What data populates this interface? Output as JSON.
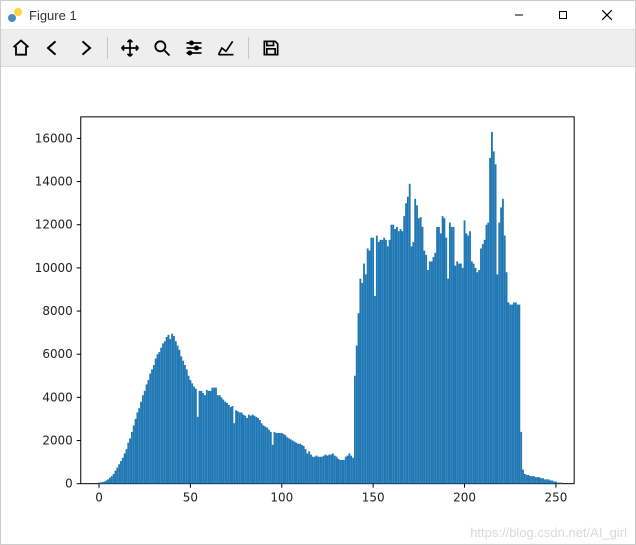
{
  "window": {
    "title": "Figure 1"
  },
  "toolbar": {
    "home": "Home",
    "back": "Back",
    "forward": "Forward",
    "pan": "Pan",
    "zoom": "Zoom",
    "configure": "Configure subplots",
    "axes": "Edit axis",
    "save": "Save"
  },
  "watermark": "https://blog.csdn.net/AI_girl",
  "chart_data": {
    "type": "bar",
    "title": "",
    "xlabel": "",
    "ylabel": "",
    "xlim": [
      -10,
      260
    ],
    "ylim": [
      0,
      17000
    ],
    "xticks": [
      0,
      50,
      100,
      150,
      200,
      250
    ],
    "yticks": [
      0,
      2000,
      4000,
      6000,
      8000,
      10000,
      12000,
      14000,
      16000
    ],
    "color": "#1f77b4",
    "x": [
      0,
      1,
      2,
      3,
      4,
      5,
      6,
      7,
      8,
      9,
      10,
      11,
      12,
      13,
      14,
      15,
      16,
      17,
      18,
      19,
      20,
      21,
      22,
      23,
      24,
      25,
      26,
      27,
      28,
      29,
      30,
      31,
      32,
      33,
      34,
      35,
      36,
      37,
      38,
      39,
      40,
      41,
      42,
      43,
      44,
      45,
      46,
      47,
      48,
      49,
      50,
      51,
      52,
      53,
      54,
      55,
      56,
      57,
      58,
      59,
      60,
      61,
      62,
      63,
      64,
      65,
      66,
      67,
      68,
      69,
      70,
      71,
      72,
      73,
      74,
      75,
      76,
      77,
      78,
      79,
      80,
      81,
      82,
      83,
      84,
      85,
      86,
      87,
      88,
      89,
      90,
      91,
      92,
      93,
      94,
      95,
      96,
      97,
      98,
      99,
      100,
      101,
      102,
      103,
      104,
      105,
      106,
      107,
      108,
      109,
      110,
      111,
      112,
      113,
      114,
      115,
      116,
      117,
      118,
      119,
      120,
      121,
      122,
      123,
      124,
      125,
      126,
      127,
      128,
      129,
      130,
      131,
      132,
      133,
      134,
      135,
      136,
      137,
      138,
      139,
      140,
      141,
      142,
      143,
      144,
      145,
      146,
      147,
      148,
      149,
      150,
      151,
      152,
      153,
      154,
      155,
      156,
      157,
      158,
      159,
      160,
      161,
      162,
      163,
      164,
      165,
      166,
      167,
      168,
      169,
      170,
      171,
      172,
      173,
      174,
      175,
      176,
      177,
      178,
      179,
      180,
      181,
      182,
      183,
      184,
      185,
      186,
      187,
      188,
      189,
      190,
      191,
      192,
      193,
      194,
      195,
      196,
      197,
      198,
      199,
      200,
      201,
      202,
      203,
      204,
      205,
      206,
      207,
      208,
      209,
      210,
      211,
      212,
      213,
      214,
      215,
      216,
      217,
      218,
      219,
      220,
      221,
      222,
      223,
      224,
      225,
      226,
      227,
      228,
      229,
      230,
      231,
      232,
      233,
      234,
      235,
      236,
      237,
      238,
      239,
      240,
      241,
      242,
      243,
      244,
      245,
      246,
      247,
      248,
      249,
      250,
      251,
      252,
      253,
      254,
      255
    ],
    "values": [
      50,
      60,
      80,
      100,
      150,
      200,
      280,
      350,
      450,
      600,
      750,
      900,
      1050,
      1200,
      1400,
      1600,
      1900,
      2100,
      2400,
      2700,
      3000,
      3300,
      3500,
      3800,
      4100,
      4300,
      4600,
      4800,
      5100,
      5300,
      5500,
      5800,
      6000,
      6100,
      6300,
      6500,
      6600,
      6800,
      6900,
      6700,
      6950,
      6850,
      6600,
      6400,
      6200,
      5900,
      5700,
      5500,
      5300,
      5000,
      4800,
      4650,
      4500,
      4400,
      3100,
      4300,
      4300,
      4200,
      4100,
      4350,
      4300,
      4300,
      4450,
      4450,
      4450,
      4100,
      4100,
      4000,
      3900,
      3800,
      3750,
      3650,
      3550,
      3600,
      2800,
      3400,
      3350,
      3300,
      3300,
      3200,
      3150,
      3050,
      3200,
      3150,
      3200,
      3150,
      3100,
      3050,
      2950,
      2800,
      2700,
      2650,
      2600,
      2500,
      2400,
      1800,
      2400,
      2350,
      2350,
      2350,
      2350,
      2300,
      2250,
      2150,
      2100,
      2050,
      2000,
      1950,
      1900,
      1850,
      1850,
      1800,
      1750,
      1600,
      1400,
      1500,
      1350,
      1250,
      1250,
      1300,
      1250,
      1250,
      1250,
      1300,
      1350,
      1300,
      1350,
      1350,
      1400,
      1300,
      1250,
      1150,
      1100,
      1100,
      1100,
      1250,
      1300,
      1400,
      1300,
      1200,
      5000,
      6400,
      7900,
      9500,
      9300,
      10200,
      9700,
      10900,
      10800,
      11400,
      11400,
      8700,
      11500,
      11200,
      11300,
      11300,
      11400,
      11300,
      11000,
      11300,
      12000,
      12000,
      11800,
      11900,
      11700,
      11800,
      11700,
      12400,
      13000,
      13300,
      13900,
      11000,
      11200,
      13200,
      12900,
      12300,
      12350,
      11900,
      10800,
      10600,
      9900,
      10300,
      10300,
      10500,
      10700,
      11900,
      11900,
      11600,
      12400,
      12300,
      11400,
      9500,
      12100,
      11900,
      11900,
      10100,
      10300,
      10200,
      10200,
      10000,
      12200,
      11600,
      11500,
      11700,
      10300,
      10200,
      10000,
      9800,
      9900,
      10900,
      11100,
      11300,
      12000,
      12100,
      15100,
      16300,
      15400,
      14800,
      9700,
      12100,
      12800,
      13200,
      11500,
      9800,
      8400,
      8300,
      8300,
      8400,
      8400,
      8300,
      8300,
      2400,
      650,
      450,
      400,
      400,
      350,
      350,
      350,
      300,
      300,
      300,
      250,
      250,
      200,
      200,
      200,
      150,
      150,
      100,
      100,
      50,
      50,
      50,
      0,
      0
    ]
  }
}
